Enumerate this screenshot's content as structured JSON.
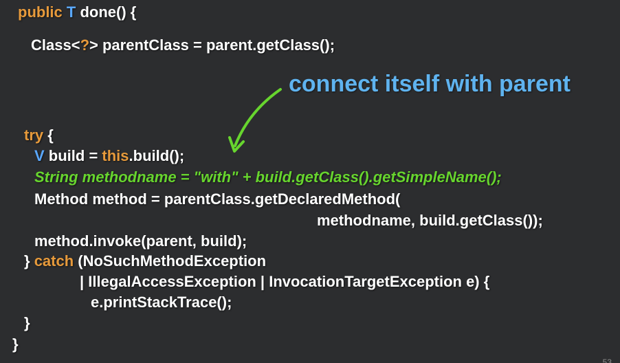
{
  "slide": {
    "annotation": "connect itself with parent",
    "page_number": "53",
    "colors": {
      "background": "#2c2d2f",
      "keyword": "#e79a3b",
      "type": "#5aa8ff",
      "highlight": "#67d52e",
      "annotation": "#5fb3ef",
      "text": "#ffffff"
    },
    "code": {
      "l1": {
        "kw": "public",
        "tp": "T",
        "rest": "done() {"
      },
      "l2": {
        "text": "Class<",
        "q": "?",
        "rest": "> parentClass = parent.getClass();"
      },
      "l3": {
        "kw": "try",
        "rest": " {"
      },
      "l4": {
        "tp": "V",
        "mid": " build = ",
        "kw": "this",
        "rest": ".build();"
      },
      "l5": {
        "text": "String methodname = \"with\" + build.getClass().getSimpleName();"
      },
      "l6": {
        "text": "Method method = parentClass.getDeclaredMethod("
      },
      "l7": {
        "text": "methodname, build.getClass());"
      },
      "l8": {
        "text": "method.invoke(parent, build);"
      },
      "l9": {
        "pre": "} ",
        "kw": "catch",
        "rest": " (NoSuchMethodException"
      },
      "l10": {
        "text": "| IllegalAccessException | InvocationTargetException e) {"
      },
      "l11": {
        "text": "e.printStackTrace();"
      },
      "l12": {
        "text": "}"
      },
      "l13": {
        "text": "}"
      }
    }
  }
}
